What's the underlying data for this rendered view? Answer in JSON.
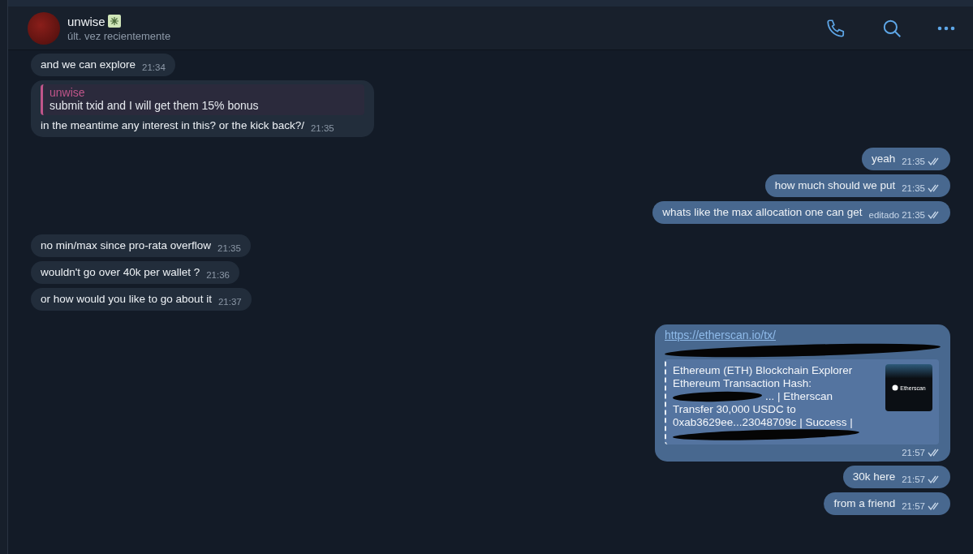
{
  "header": {
    "name": "unwise",
    "status": "últ. vez recientemente"
  },
  "messages": [
    {
      "kind": "text",
      "outgoing": false,
      "text": "and we can explore",
      "time": "21:34"
    },
    {
      "kind": "reply",
      "outgoing": false,
      "reply_author": "unwise",
      "reply_text": "submit txid and I will get them 15% bonus",
      "text": "in the meantime any interest in this? or the kick back?/",
      "time": "21:35"
    },
    {
      "kind": "text",
      "outgoing": true,
      "text": "yeah",
      "time": "21:35",
      "read": true
    },
    {
      "kind": "text",
      "outgoing": true,
      "text": "how much should we put",
      "time": "21:35",
      "read": true
    },
    {
      "kind": "text",
      "outgoing": true,
      "text": "whats like the max allocation one can get",
      "edited": "editado",
      "time": "21:35",
      "read": true
    },
    {
      "kind": "text",
      "outgoing": false,
      "text": "no min/max since pro-rata overflow",
      "time": "21:35"
    },
    {
      "kind": "text",
      "outgoing": false,
      "text": "wouldn't go over 40k per wallet ?",
      "time": "21:36"
    },
    {
      "kind": "text",
      "outgoing": false,
      "text": "or how would you like to go about it",
      "time": "21:37"
    },
    {
      "kind": "link",
      "outgoing": true,
      "link": "https://etherscan.io/tx/",
      "preview_lines": [
        "Ethereum (ETH) Blockchain Explorer",
        "Ethereum Transaction Hash:",
        "... | Etherscan",
        "Transfer 30,000 USDC to",
        "0xab3629ee...23048709c | Success |"
      ],
      "thumb_label": "Etherscan",
      "time": "21:57",
      "read": true
    },
    {
      "kind": "text",
      "outgoing": true,
      "text": "30k here",
      "time": "21:57",
      "read": true
    },
    {
      "kind": "text",
      "outgoing": true,
      "text": "from a friend",
      "time": "21:57",
      "read": true
    }
  ]
}
